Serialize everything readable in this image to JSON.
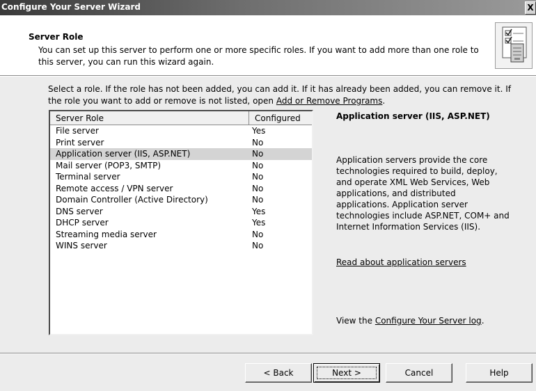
{
  "window": {
    "title": "Configure Your Server Wizard",
    "close_label": "X"
  },
  "header": {
    "title": "Server Role",
    "description": "You can set up this server to perform one or more specific roles. If you want to add more than one role to this server, you can run this wizard again.",
    "icon": "wizard-checklist-icon"
  },
  "instructions": {
    "text": "Select a role. If the role has not been added, you can add it. If it has already been added, you can remove it. If the role you want to add or remove is not listed, open",
    "link": "Add or Remove Programs",
    "end": "."
  },
  "listview": {
    "columns": [
      "Server Role",
      "Configured"
    ],
    "rows": [
      {
        "role": "File server",
        "configured": "Yes"
      },
      {
        "role": "Print server",
        "configured": "No"
      },
      {
        "role": "Application server (IIS, ASP.NET)",
        "configured": "No"
      },
      {
        "role": "Mail server (POP3, SMTP)",
        "configured": "No"
      },
      {
        "role": "Terminal server",
        "configured": "No"
      },
      {
        "role": "Remote access / VPN server",
        "configured": "No"
      },
      {
        "role": "Domain Controller (Active Directory)",
        "configured": "No"
      },
      {
        "role": "DNS server",
        "configured": "Yes"
      },
      {
        "role": "DHCP server",
        "configured": "Yes"
      },
      {
        "role": "Streaming media server",
        "configured": "No"
      },
      {
        "role": "WINS server",
        "configured": "No"
      }
    ]
  },
  "detail": {
    "title": "Application server (IIS, ASP.NET)",
    "body": "Application servers provide the core technologies required to build, deploy, and operate XML Web Services, Web applications, and distributed applications. Application server technologies include ASP.NET, COM+ and Internet Information Services (IIS).",
    "read_link": "Read about application servers",
    "log_prefix": "View the",
    "log_link": "Configure Your Server log",
    "log_suffix": "."
  },
  "buttons": {
    "back": "< Back",
    "next": "Next >",
    "cancel": "Cancel",
    "help": "Help"
  }
}
